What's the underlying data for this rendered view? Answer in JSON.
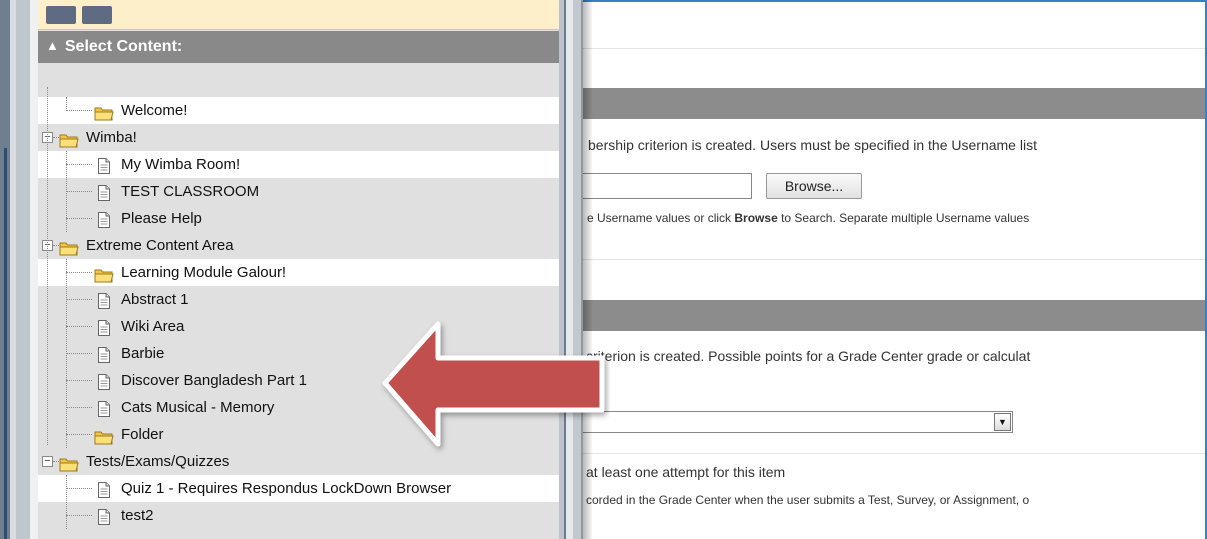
{
  "panel": {
    "title": "Select Content:",
    "items": [
      {
        "label": "Welcome!",
        "icon": "folder-icon",
        "depth": 1,
        "highlight": true
      },
      {
        "label": "Wimba!",
        "icon": "folder-icon",
        "depth": 0,
        "toggle": "minus"
      },
      {
        "label": "My Wimba Room!",
        "icon": "document-icon",
        "depth": 1,
        "highlight": true
      },
      {
        "label": "TEST CLASSROOM",
        "icon": "document-icon",
        "depth": 1
      },
      {
        "label": "Please Help",
        "icon": "document-icon",
        "depth": 1
      },
      {
        "label": "Extreme Content Area",
        "icon": "folder-icon",
        "depth": 0,
        "toggle": "minus"
      },
      {
        "label": "Learning Module Galour!",
        "icon": "folder-icon",
        "depth": 1,
        "highlight": true
      },
      {
        "label": "Abstract 1",
        "icon": "document-icon",
        "depth": 1
      },
      {
        "label": "Wiki Area",
        "icon": "document-icon",
        "depth": 1
      },
      {
        "label": "Barbie",
        "icon": "document-icon",
        "depth": 1
      },
      {
        "label": "Discover Bangladesh Part 1",
        "icon": "document-icon",
        "depth": 1
      },
      {
        "label": "Cats Musical - Memory",
        "icon": "document-icon",
        "depth": 1
      },
      {
        "label": "Folder",
        "icon": "folder-icon",
        "depth": 1
      },
      {
        "label": "Tests/Exams/Quizzes",
        "icon": "folder-icon",
        "depth": 0,
        "toggle": "minus"
      },
      {
        "label": "Quiz 1 - Requires Respondus LockDown Browser",
        "icon": "document-icon",
        "depth": 1,
        "highlight": true
      },
      {
        "label": "test2",
        "icon": "document-icon",
        "depth": 1
      }
    ]
  },
  "background_page": {
    "membership_text": "bership criterion is created. Users must be specified in the Username list",
    "browse_button": "Browse...",
    "username_help_prefix": "e Username values or click ",
    "username_help_bold": "Browse",
    "username_help_suffix": " to Search. Separate multiple Username values",
    "grade_text": " criterion is created. Possible points for a Grade Center grade or calculat",
    "select_arrow": "▼",
    "attempt_text": "at least one attempt for this item",
    "recorded_text": "corded in the Grade Center when the user submits a Test, Survey, or Assignment, o"
  },
  "annotation": {
    "arrow_color": "#c0504d",
    "arrow_outline": "#ffffff"
  },
  "colors": {
    "panel_title_bg": "#898989",
    "panel_top_bg": "#fdefc9",
    "frame_blue": "#3a7fc4"
  }
}
